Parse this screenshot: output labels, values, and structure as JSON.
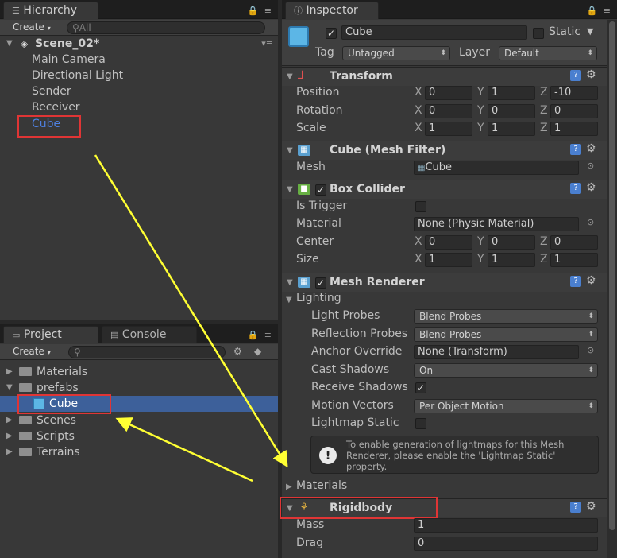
{
  "hierarchy": {
    "tab_label": "Hierarchy",
    "create_label": "Create",
    "search_placeholder": "All",
    "scene_name": "Scene_02*",
    "items": [
      "Main Camera",
      "Directional Light",
      "Sender",
      "Receiver",
      "Cube"
    ]
  },
  "project": {
    "tab_label": "Project",
    "console_tab_label": "Console",
    "create_label": "Create",
    "items": [
      {
        "label": "Materials",
        "type": "folder"
      },
      {
        "label": "prefabs",
        "type": "folder"
      },
      {
        "label": "Cube",
        "type": "prefab"
      },
      {
        "label": "Scenes",
        "type": "folder"
      },
      {
        "label": "Scripts",
        "type": "folder"
      },
      {
        "label": "Terrains",
        "type": "folder"
      }
    ]
  },
  "inspector": {
    "tab_label": "Inspector",
    "object_name": "Cube",
    "static_label": "Static",
    "tag_label": "Tag",
    "tag_value": "Untagged",
    "layer_label": "Layer",
    "layer_value": "Default",
    "transform": {
      "title": "Transform",
      "position_label": "Position",
      "rotation_label": "Rotation",
      "scale_label": "Scale",
      "position": {
        "x": "0",
        "y": "1",
        "z": "-10"
      },
      "rotation": {
        "x": "0",
        "y": "0",
        "z": "0"
      },
      "scale": {
        "x": "1",
        "y": "1",
        "z": "1"
      }
    },
    "mesh_filter": {
      "title": "Cube (Mesh Filter)",
      "mesh_label": "Mesh",
      "mesh_value": "Cube"
    },
    "box_collider": {
      "title": "Box Collider",
      "is_trigger_label": "Is Trigger",
      "material_label": "Material",
      "material_value": "None (Physic Material)",
      "center_label": "Center",
      "size_label": "Size",
      "center": {
        "x": "0",
        "y": "0",
        "z": "0"
      },
      "size": {
        "x": "1",
        "y": "1",
        "z": "1"
      }
    },
    "mesh_renderer": {
      "title": "Mesh Renderer",
      "lighting_label": "Lighting",
      "light_probes_label": "Light Probes",
      "light_probes_value": "Blend Probes",
      "reflection_probes_label": "Reflection Probes",
      "reflection_probes_value": "Blend Probes",
      "anchor_override_label": "Anchor Override",
      "anchor_override_value": "None (Transform)",
      "cast_shadows_label": "Cast Shadows",
      "cast_shadows_value": "On",
      "receive_shadows_label": "Receive Shadows",
      "motion_vectors_label": "Motion Vectors",
      "motion_vectors_value": "Per Object Motion",
      "lightmap_static_label": "Lightmap Static",
      "help_text": "To enable generation of lightmaps for this Mesh Renderer, please enable the 'Lightmap Static' property.",
      "materials_label": "Materials"
    },
    "rigidbody": {
      "title": "Rigidbody",
      "mass_label": "Mass",
      "mass_value": "1",
      "drag_label": "Drag",
      "drag_value": "0"
    }
  },
  "axis_labels": {
    "x": "X",
    "y": "Y",
    "z": "Z"
  },
  "colors": {
    "highlight_box": "#e03535",
    "arrow": "#ffff33",
    "selection": "#3d609a",
    "link_blue": "#4f80e0"
  }
}
